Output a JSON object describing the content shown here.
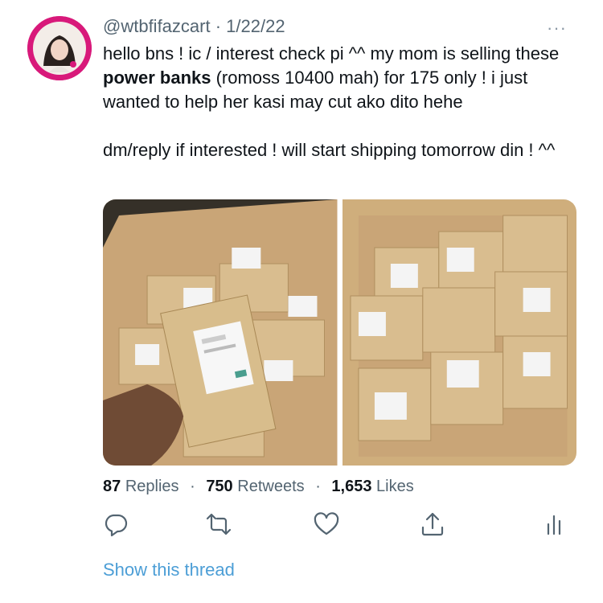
{
  "tweet": {
    "handle": "@wtbfifazcart",
    "separator": "·",
    "date": "1/22/22",
    "more_label": "···",
    "text_part1": "hello bns ! ic / interest check pi ^^ my mom is selling these ",
    "text_bold": "power banks",
    "text_part2": " (romoss 10400 mah) for 175 only ! i just wanted to help her kasi may cut ako dito hehe",
    "text_para2": "dm/reply if interested ! will start shipping tomorrow din ! ^^"
  },
  "stats": {
    "replies_count": "87",
    "replies_label": "Replies",
    "retweets_count": "750",
    "retweets_label": "Retweets",
    "likes_count": "1,653",
    "likes_label": "Likes",
    "separator": "·"
  },
  "actions": [
    {
      "icon": "reply-icon"
    },
    {
      "icon": "retweet-icon"
    },
    {
      "icon": "heart-icon"
    },
    {
      "icon": "share-icon"
    },
    {
      "icon": "analytics-icon"
    }
  ],
  "thread_link": "Show this thread",
  "colors": {
    "text": "#0f1419",
    "secondary": "#536471",
    "link": "#4c9ed6",
    "icon": "#536471",
    "avatar_ring": "#d8197a"
  }
}
